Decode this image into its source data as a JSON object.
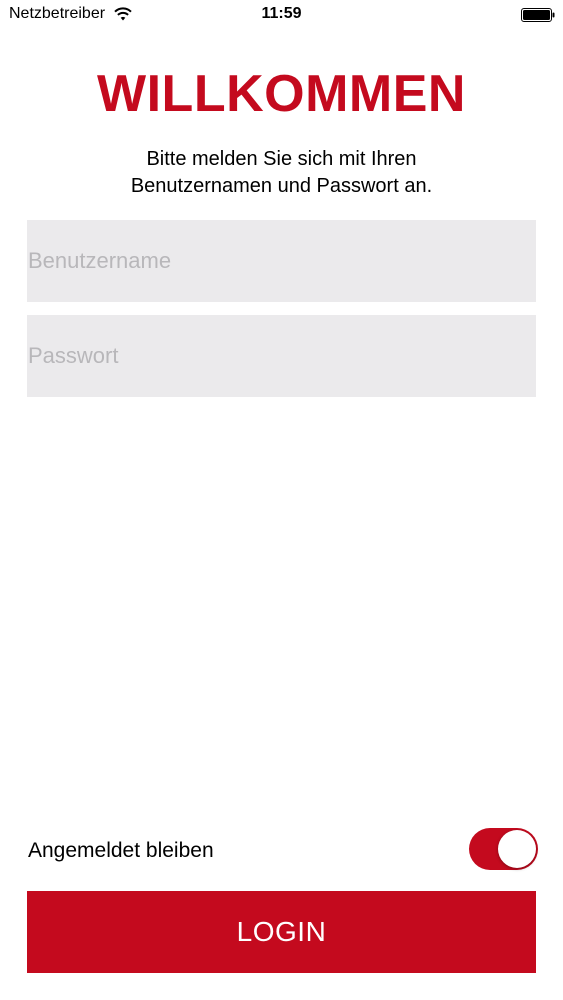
{
  "status_bar": {
    "carrier": "Netzbetreiber",
    "time": "11:59",
    "icons": [
      "wifi-icon",
      "battery-icon"
    ]
  },
  "header": {
    "title": "WILLKOMMEN",
    "subtitle_line1": "Bitte melden Sie sich mit Ihren",
    "subtitle_line2": "Benutzernamen und Passwort an."
  },
  "form": {
    "username_placeholder": "Benutzername",
    "username_value": "",
    "password_placeholder": "Passwort",
    "password_value": "",
    "remember_label": "Angemeldet bleiben",
    "remember_on": true,
    "login_label": "LOGIN"
  },
  "colors": {
    "accent": "#c40a1e",
    "field_background": "#ebeaec",
    "placeholder": "#b8b7ba"
  }
}
